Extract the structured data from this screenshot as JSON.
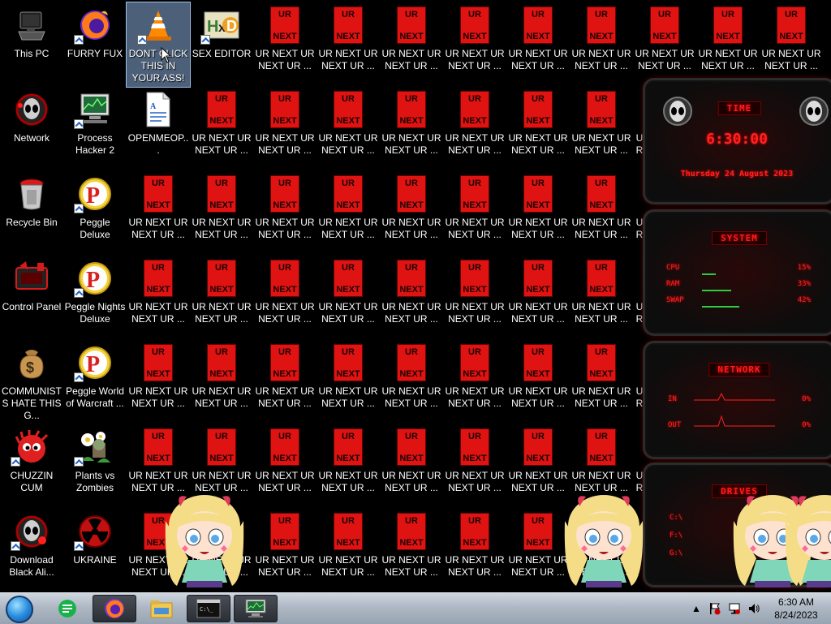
{
  "desktop_icons": [
    {
      "label": "This PC",
      "icon": "this-pc-icon"
    },
    {
      "label": "FURRY FUX",
      "icon": "firefox-icon"
    },
    {
      "label": "DONT CLICK THIS IN YOUR ASS!",
      "icon": "vlc-cone-icon",
      "selected": true
    },
    {
      "label": "SEX EDITOR",
      "icon": "hxd-editor-icon"
    },
    {
      "label": "Network",
      "icon": "network-alien-icon"
    },
    {
      "label": "Process Hacker 2",
      "icon": "process-hacker-icon"
    },
    {
      "label": "OPENMEOP...",
      "icon": "document-icon"
    },
    {
      "label": "Recycle Bin",
      "icon": "recycle-bin-icon"
    },
    {
      "label": "Peggle Deluxe",
      "icon": "peggle-icon"
    },
    {
      "label": "Control Panel",
      "icon": "control-panel-icon"
    },
    {
      "label": "Peggle Nights Deluxe",
      "icon": "peggle-icon"
    },
    {
      "label": "COMMUNISTS HATE THIS G...",
      "icon": "money-bag-icon"
    },
    {
      "label": "Peggle World of Warcraft ...",
      "icon": "peggle-icon"
    },
    {
      "label": "CHUZZIN CUM",
      "icon": "chuzzle-icon"
    },
    {
      "label": "Plants vs Zombies",
      "icon": "plants-vs-zombies-icon"
    },
    {
      "label": "Download Black Ali...",
      "icon": "alien-download-icon"
    },
    {
      "label": "UKRAINE",
      "icon": "radiation-icon"
    }
  ],
  "ur_next": {
    "top": "UR",
    "bottom": "NEXT",
    "label": "UR NEXT UR NEXT UR ...",
    "label_clipped": "UR"
  },
  "widget": {
    "time_title": "TIME",
    "time": "6:30:00",
    "date": "Thursday 24 August 2023",
    "system_title": "SYSTEM",
    "cpu_label": "CPU",
    "cpu_value": "15%",
    "ram_label": "RAM",
    "ram_value": "33%",
    "swap_label": "SWAP",
    "swap_value": "42%",
    "cpu_level": 0.15,
    "ram_level": 0.33,
    "swap_level": 0.42,
    "network_title": "NETWORK",
    "in_label": "IN",
    "in_value": "0%",
    "out_label": "OUT",
    "out_value": "0%",
    "drives_title": "DRIVES",
    "drives": [
      "C:\\",
      "F:\\",
      "G:\\"
    ]
  },
  "taskbar": {
    "pinned": [
      "start-orb",
      "green-app-icon",
      "firefox-icon",
      "file-explorer-icon",
      "command-prompt-icon",
      "process-hacker-icon"
    ],
    "clock_time": "6:30 AM",
    "clock_date": "8/24/2023"
  },
  "colors": {
    "ur_red": "#e01313",
    "widget_red": "#ff1a1a",
    "taskbar": "#aeb8c4"
  }
}
